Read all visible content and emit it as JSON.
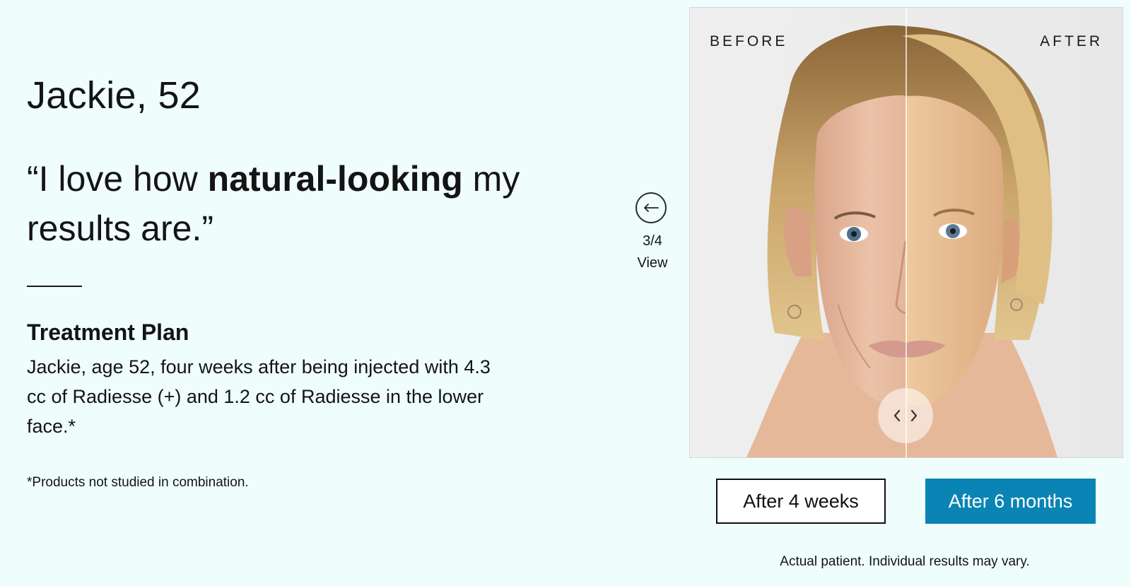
{
  "patient": {
    "name_age": "Jackie, 52",
    "quote_open": "“I love how ",
    "quote_bold": "natural-looking",
    "quote_close": " my results are.”"
  },
  "treatment": {
    "title": "Treatment Plan",
    "description": "Jackie, age 52, four weeks after being injected with 4.3 cc of Radiesse (+) and 1.2 cc of Radiesse in the lower face.*",
    "footnote": "*Products not studied in combination."
  },
  "gallery": {
    "counter": "3/4",
    "view_label": "View",
    "before_label": "BEFORE",
    "after_label": "AFTER",
    "disclaimer": "Actual patient. Individual results may vary."
  },
  "timeline": {
    "option_4_weeks": "After 4 weeks",
    "option_6_months": "After 6 months",
    "selected": "After 6 months"
  },
  "colors": {
    "background": "#effefd",
    "accent": "#0a84b4"
  },
  "icons": {
    "prev": "arrow-left-icon",
    "handle_left": "chevron-left-icon",
    "handle_right": "chevron-right-icon"
  }
}
